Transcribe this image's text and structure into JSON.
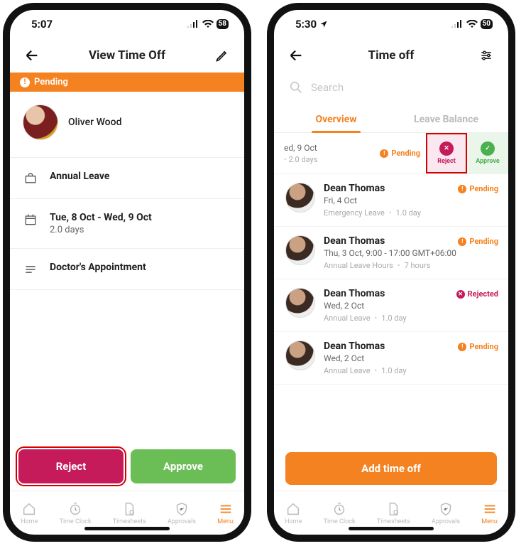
{
  "left": {
    "status_time": "5:07",
    "battery": "58",
    "title": "View Time Off",
    "pending_label": "Pending",
    "user_name": "Oliver Wood",
    "leave_type": "Annual Leave",
    "date_range": "Tue, 8 Oct - Wed, 9 Oct",
    "duration": "2.0 days",
    "note": "Doctor's Appointment",
    "reject_label": "Reject",
    "approve_label": "Approve"
  },
  "right": {
    "status_time": "5:30",
    "battery": "50",
    "title": "Time off",
    "search_placeholder": "Search",
    "tab_overview": "Overview",
    "tab_balance": "Leave Balance",
    "swipe": {
      "date_line": "ed, 9 Oct",
      "duration_line": "2.0 days",
      "pending_label": "Pending",
      "reject_label": "Reject",
      "approve_label": "Approve"
    },
    "entries": [
      {
        "name": "Dean Thomas",
        "date": "Fri, 4 Oct",
        "type": "Emergency Leave",
        "dur": "1.0 day",
        "status": "Pending"
      },
      {
        "name": "Dean Thomas",
        "date": "Thu, 3 Oct, 9:00 - 17:00 GMT+06:00",
        "type": "Annual Leave Hours",
        "dur": "7 hours",
        "status": "Pending"
      },
      {
        "name": "Dean Thomas",
        "date": "Wed, 2 Oct",
        "type": "Annual Leave",
        "dur": "1.0 day",
        "status": "Rejected"
      },
      {
        "name": "Dean Thomas",
        "date": "Wed, 2 Oct",
        "type": "Annual Leave",
        "dur": "1.0 day",
        "status": "Pending"
      }
    ],
    "add_timeoff_label": "Add time off"
  },
  "tabs": {
    "home": "Home",
    "timeclock": "Time Clock",
    "timesheets": "Timesheets",
    "approvals": "Approvals",
    "menu": "Menu"
  }
}
